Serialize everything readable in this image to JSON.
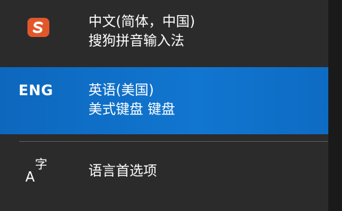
{
  "input_menu": {
    "items": [
      {
        "icon": "sogou-s-icon",
        "line1": "中文(简体，中国)",
        "line2": "搜狗拼音输入法"
      },
      {
        "code": "ENG",
        "line1": "英语(美国)",
        "line2": "美式键盘 键盘",
        "selected": true
      }
    ],
    "options": {
      "icon": "language-options-icon",
      "icon_glyph_latin": "A",
      "icon_glyph_cjk": "字",
      "label": "语言首选项"
    }
  },
  "colors": {
    "background": "#2b2b2b",
    "selected": "#0f6bc4",
    "sogou_orange": "#e2572a",
    "text": "#ffffff"
  }
}
